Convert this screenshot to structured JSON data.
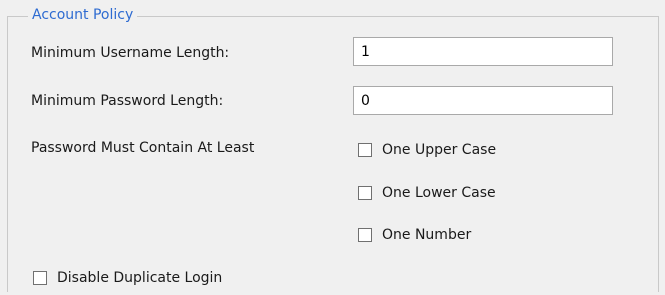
{
  "group": {
    "title": "Account Policy"
  },
  "fields": {
    "min_username": {
      "label": "Minimum Username Length:",
      "value": "1"
    },
    "min_password": {
      "label": "Minimum Password Length:",
      "value": "0"
    }
  },
  "password_rules": {
    "label": "Password Must Contain At Least",
    "options": [
      {
        "label": "One Upper Case",
        "checked": false
      },
      {
        "label": "One Lower Case",
        "checked": false
      },
      {
        "label": "One Number",
        "checked": false
      }
    ]
  },
  "disable_duplicate_login": {
    "label": "Disable Duplicate Login",
    "checked": false
  },
  "colors": {
    "legend_text": "#2e6bd1",
    "background": "#f0f0f0",
    "input_border": "#a9a9a9"
  }
}
